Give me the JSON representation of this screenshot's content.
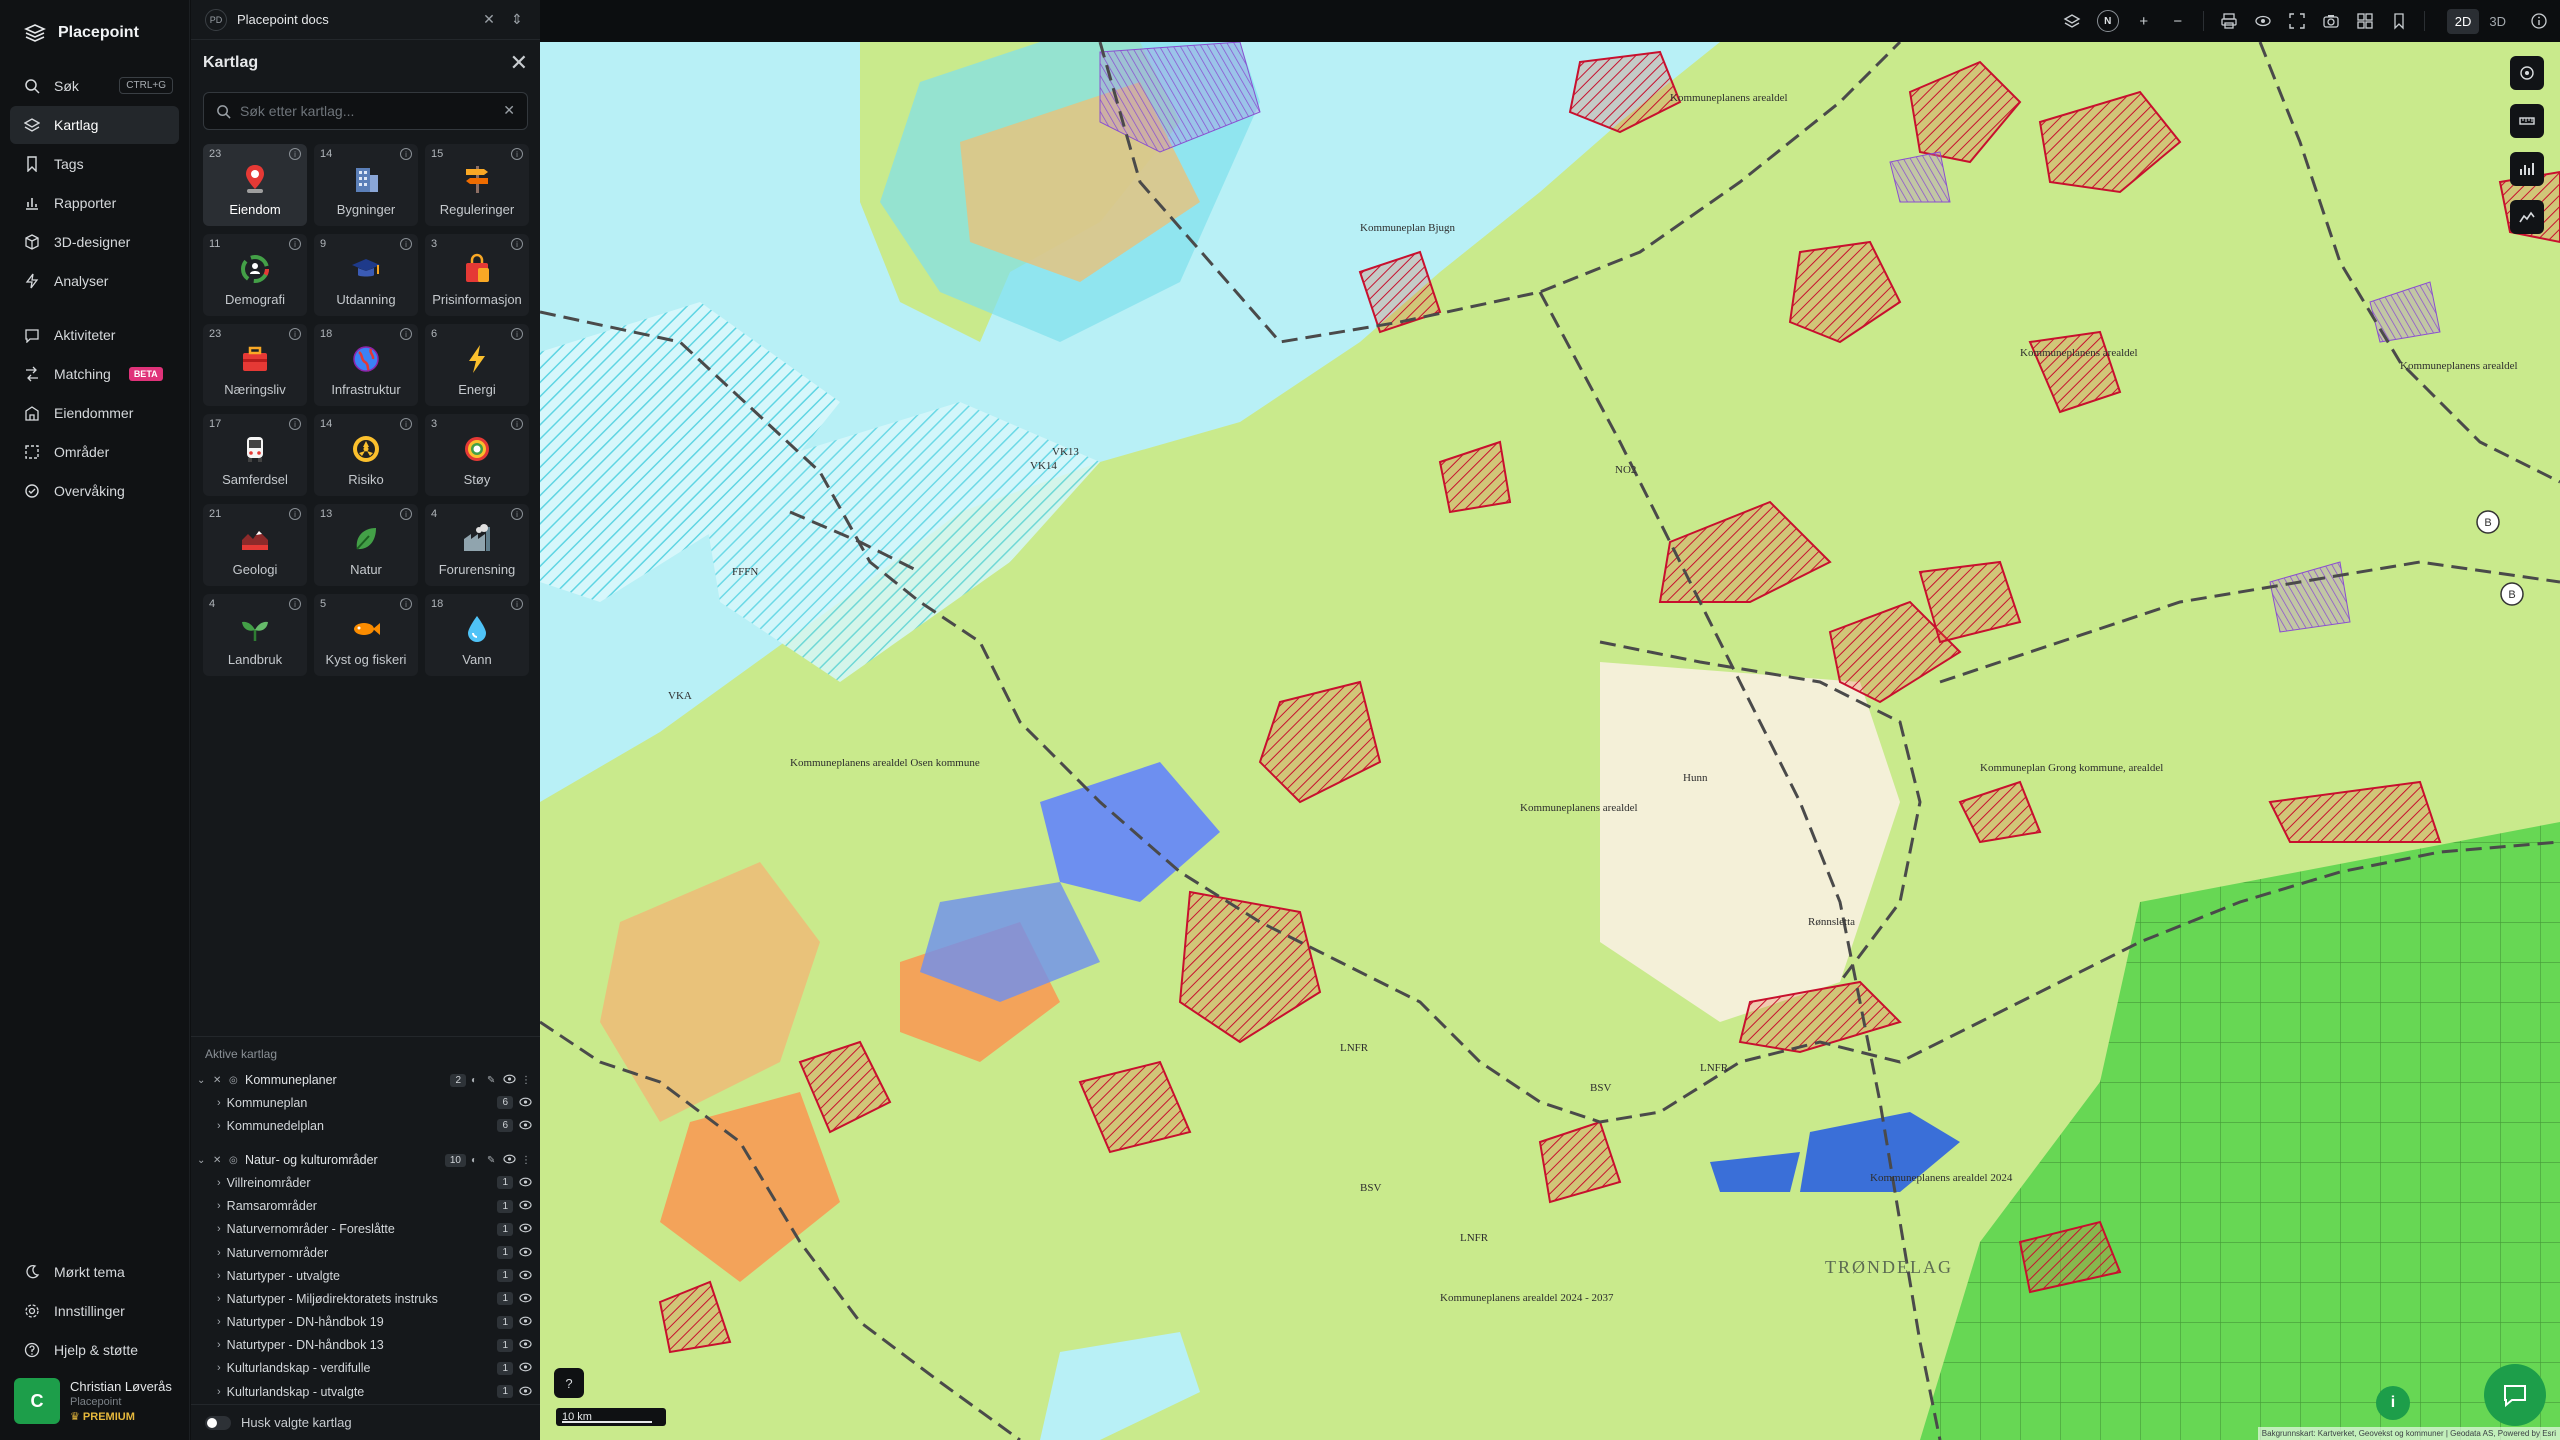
{
  "app": {
    "name": "Placepoint"
  },
  "nav": {
    "items": [
      {
        "label": "Søk",
        "icon": "search-icon",
        "shortcut": "CTRL+G"
      },
      {
        "label": "Kartlag",
        "icon": "layers-icon",
        "active": true
      },
      {
        "label": "Tags",
        "icon": "bookmark-icon"
      },
      {
        "label": "Rapporter",
        "icon": "bar-chart-icon"
      },
      {
        "label": "3D-designer",
        "icon": "cube-icon"
      },
      {
        "label": "Analyser",
        "icon": "bolt-icon"
      }
    ],
    "items2": [
      {
        "label": "Aktiviteter",
        "icon": "activity-icon"
      },
      {
        "label": "Matching",
        "icon": "matching-icon",
        "badge": "BETA"
      },
      {
        "label": "Eiendommer",
        "icon": "building-icon"
      },
      {
        "label": "Områder",
        "icon": "area-icon"
      },
      {
        "label": "Overvåking",
        "icon": "monitor-icon"
      }
    ],
    "bottom": [
      {
        "label": "Mørkt tema",
        "icon": "moon-icon"
      },
      {
        "label": "Innstillinger",
        "icon": "gear-icon"
      },
      {
        "label": "Hjelp & støtte",
        "icon": "help-icon"
      }
    ],
    "user": {
      "initial": "C",
      "name": "Christian Løverås",
      "org": "Placepoint",
      "plan": "PREMIUM"
    }
  },
  "doc": {
    "badge": "PD",
    "title": "Placepoint docs"
  },
  "panel": {
    "title": "Kartlag",
    "search_placeholder": "Søk etter kartlag...",
    "tiles": [
      {
        "count": "23",
        "label": "Eiendom",
        "icon": "property-pin-icon",
        "selected": true
      },
      {
        "count": "14",
        "label": "Bygninger",
        "icon": "buildings-icon"
      },
      {
        "count": "15",
        "label": "Reguleringer",
        "icon": "signpost-icon"
      },
      {
        "count": "11",
        "label": "Demografi",
        "icon": "demography-icon"
      },
      {
        "count": "9",
        "label": "Utdanning",
        "icon": "graduation-cap-icon"
      },
      {
        "count": "3",
        "label": "Prisinformasjon",
        "icon": "shopping-bag-icon"
      },
      {
        "count": "23",
        "label": "Næringsliv",
        "icon": "business-bag-icon"
      },
      {
        "count": "18",
        "label": "Infrastruktur",
        "icon": "globe-icon"
      },
      {
        "count": "6",
        "label": "Energi",
        "icon": "lightning-icon"
      },
      {
        "count": "17",
        "label": "Samferdsel",
        "icon": "bus-icon"
      },
      {
        "count": "14",
        "label": "Risiko",
        "icon": "hazard-icon"
      },
      {
        "count": "3",
        "label": "Støy",
        "icon": "noise-icon"
      },
      {
        "count": "21",
        "label": "Geologi",
        "icon": "terrain-icon"
      },
      {
        "count": "13",
        "label": "Natur",
        "icon": "leaf-icon"
      },
      {
        "count": "4",
        "label": "Forurensning",
        "icon": "factory-icon"
      },
      {
        "count": "4",
        "label": "Landbruk",
        "icon": "sprout-icon"
      },
      {
        "count": "5",
        "label": "Kyst og fiskeri",
        "icon": "fish-icon"
      },
      {
        "count": "18",
        "label": "Vann",
        "icon": "water-drop-icon"
      }
    ],
    "active_title": "Aktive kartlag",
    "groups": [
      {
        "name": "Kommuneplaner",
        "count": "2",
        "layers": [
          {
            "name": "Kommuneplan",
            "count": "6"
          },
          {
            "name": "Kommunedelplan",
            "count": "6"
          }
        ]
      },
      {
        "name": "Natur- og kulturområder",
        "count": "10",
        "layers": [
          {
            "name": "Villreinområder",
            "count": "1"
          },
          {
            "name": "Ramsarområder",
            "count": "1"
          },
          {
            "name": "Naturvernområder - Foreslåtte",
            "count": "1"
          },
          {
            "name": "Naturvernområder",
            "count": "1"
          },
          {
            "name": "Naturtyper - utvalgte",
            "count": "1"
          },
          {
            "name": "Naturtyper - Miljødirektoratets instruks",
            "count": "1"
          },
          {
            "name": "Naturtyper - DN-håndbok 19",
            "count": "1"
          },
          {
            "name": "Naturtyper - DN-håndbok 13",
            "count": "1"
          },
          {
            "name": "Kulturlandskap - verdifulle",
            "count": "1"
          },
          {
            "name": "Kulturlandskap - utvalgte",
            "count": "1"
          }
        ]
      }
    ],
    "remember": "Husk valgte kartlag"
  },
  "topbar": {
    "compass": "N",
    "mode_2d": "2D",
    "mode_3d": "3D"
  },
  "map": {
    "scale": "10 km",
    "attribution": "Bakgrunnskart: Kartverket, Geovekst og kommuner | Geodata AS, Powered by Esri",
    "labels": [
      "Kommuneplanens arealdel",
      "Kommuneplan Bjugn",
      "Kommuneplanens arealdel",
      "Kommuneplanens arealdel",
      "Kommuneplanens arealdel Osen kommune",
      "Kommuneplan Grong kommune, arealdel",
      "Kommuneplanens arealdel",
      "Kommuneplanens arealdel 2024",
      "Kommuneplanens arealdel 2024 - 2037",
      "TRØNDELAG",
      "Rønnsletta",
      "Hunn",
      "LNFR",
      "LNFR",
      "LNFR",
      "BSV",
      "BSV",
      "VKA",
      "FFFN",
      "VK14",
      "VK13",
      "NO2"
    ],
    "colors": {
      "sea": "#b8f0f6",
      "land": "#c9ea8c",
      "forest": "#8fd36a",
      "plan_hatch": "#c8102e",
      "water": "#3a6fd8"
    }
  }
}
